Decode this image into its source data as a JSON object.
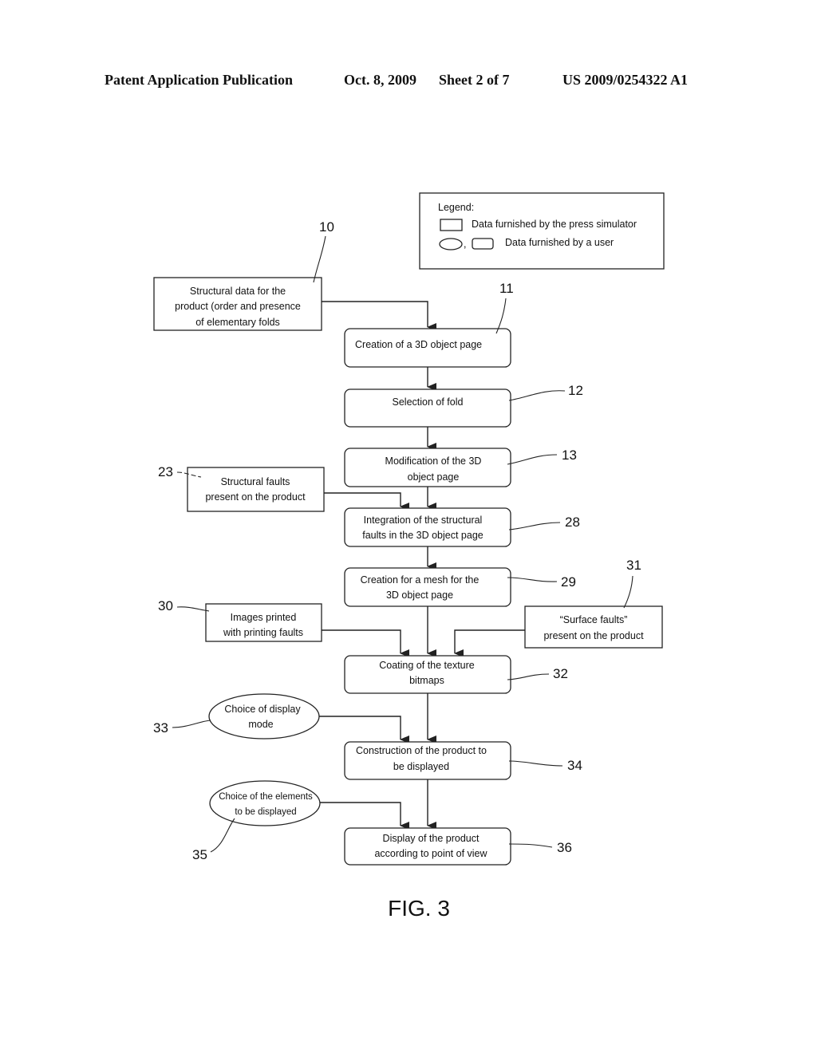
{
  "header": {
    "publication": "Patent Application Publication",
    "date": "Oct. 8, 2009",
    "sheet": "Sheet 2 of 7",
    "number": "US 2009/0254322 A1"
  },
  "legend": {
    "title": "Legend:",
    "items": [
      {
        "shape": "rectangle",
        "label": "Data furnished by the press simulator"
      },
      {
        "shape": "ellipse-or-rounded-rectangle",
        "separator": ",",
        "label": "Data furnished by a user"
      }
    ]
  },
  "nodes": [
    {
      "id": "10",
      "shape": "rectangle",
      "lines": [
        "Structural data for the",
        "product (order and presence",
        "of elementary folds"
      ]
    },
    {
      "id": "11",
      "shape": "rounded",
      "lines": [
        "Creation of a 3D object page"
      ]
    },
    {
      "id": "12",
      "shape": "rounded",
      "lines": [
        "Selection of fold"
      ]
    },
    {
      "id": "13",
      "shape": "rounded",
      "lines": [
        "Modification of the 3D",
        "object page"
      ]
    },
    {
      "id": "23",
      "shape": "rectangle",
      "lines": [
        "Structural faults",
        "present on the product"
      ]
    },
    {
      "id": "28",
      "shape": "rounded",
      "lines": [
        "Integration of the structural",
        "faults in the 3D object page"
      ]
    },
    {
      "id": "29",
      "shape": "rounded",
      "lines": [
        "Creation for a mesh for the",
        "3D object page"
      ]
    },
    {
      "id": "30",
      "shape": "rectangle",
      "lines": [
        "Images printed",
        "with printing faults"
      ]
    },
    {
      "id": "31",
      "shape": "rectangle",
      "lines": [
        "“Surface faults”",
        "present on the product"
      ]
    },
    {
      "id": "32",
      "shape": "rounded",
      "lines": [
        "Coating of the texture",
        "bitmaps"
      ]
    },
    {
      "id": "33",
      "shape": "ellipse",
      "lines": [
        "Choice of display",
        "mode"
      ]
    },
    {
      "id": "34",
      "shape": "rounded",
      "lines": [
        "Construction of the product to",
        "be displayed"
      ]
    },
    {
      "id": "35",
      "shape": "ellipse",
      "lines": [
        "Choice of the elements",
        "to be displayed"
      ]
    },
    {
      "id": "36",
      "shape": "rounded",
      "lines": [
        "Display of the product",
        "according to point of view"
      ]
    }
  ],
  "edges": [
    {
      "from": "10",
      "to": "11"
    },
    {
      "from": "11",
      "to": "12"
    },
    {
      "from": "12",
      "to": "13"
    },
    {
      "from": "13",
      "to": "28"
    },
    {
      "from": "23",
      "to": "28"
    },
    {
      "from": "28",
      "to": "29"
    },
    {
      "from": "29",
      "to": "32"
    },
    {
      "from": "30",
      "to": "32"
    },
    {
      "from": "31",
      "to": "32"
    },
    {
      "from": "32",
      "to": "34"
    },
    {
      "from": "33",
      "to": "34"
    },
    {
      "from": "34",
      "to": "36"
    },
    {
      "from": "35",
      "to": "36"
    }
  ],
  "figure_label": "FIG. 3"
}
